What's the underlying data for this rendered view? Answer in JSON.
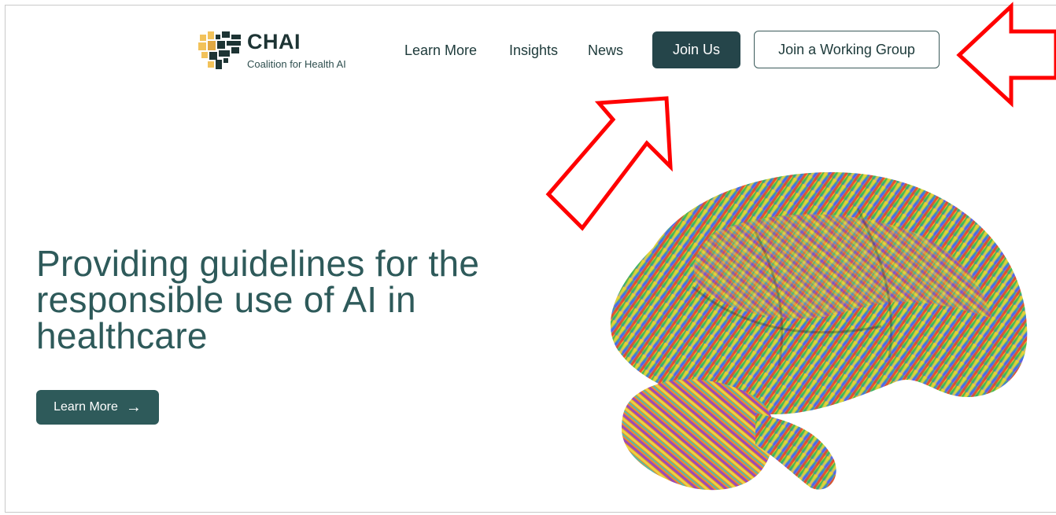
{
  "brand": {
    "name": "CHAI",
    "tagline": "Coalition for Health AI"
  },
  "nav": {
    "items": [
      {
        "label": "Learn More"
      },
      {
        "label": "Insights"
      },
      {
        "label": "News"
      }
    ],
    "join_us": "Join Us",
    "join_working_group": "Join a Working Group"
  },
  "hero": {
    "title_lines": [
      "Providing guidelines for the",
      "responsible use of AI in",
      "healthcare"
    ],
    "button_label": "Learn More",
    "button_icon": "arrow-right-icon"
  },
  "colors": {
    "primary": "#25454a",
    "heading": "#2e5a5a",
    "annotation": "#ff0000",
    "logo_gold": "#f2c25a",
    "logo_dark": "#1d3434"
  }
}
